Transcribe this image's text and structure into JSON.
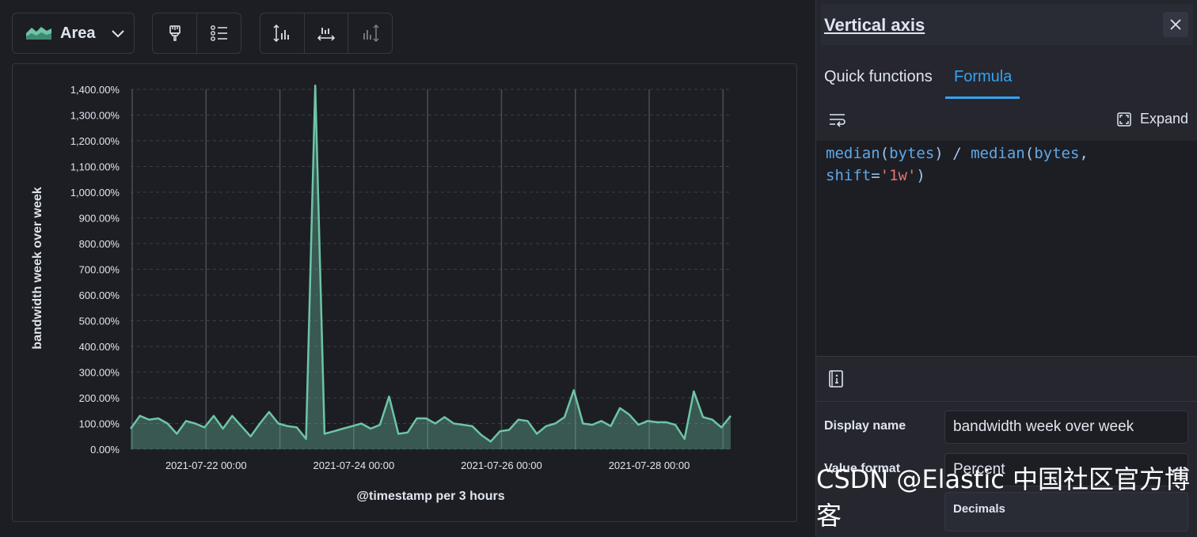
{
  "toolbar": {
    "chart_type_label": "Area",
    "icons": [
      "area-chart-icon",
      "chevron-down-icon",
      "paintbrush-icon",
      "legend-list-icon",
      "left-axis-icon",
      "bottom-axis-icon",
      "right-axis-icon"
    ]
  },
  "colors": {
    "series": "#6dc5a5",
    "accent": "#36a2ef",
    "string": "#e57373"
  },
  "chart_data": {
    "type": "area",
    "xlabel": "@timestamp per 3 hours",
    "ylabel": "bandwidth week over week",
    "ylim": [
      0,
      1400
    ],
    "y_ticks": [
      "0.00%",
      "100.00%",
      "200.00%",
      "300.00%",
      "400.00%",
      "500.00%",
      "600.00%",
      "700.00%",
      "800.00%",
      "900.00%",
      "1,000.00%",
      "1,100.00%",
      "1,200.00%",
      "1,300.00%",
      "1,400.00%"
    ],
    "x_ticks": [
      "2021-07-22 00:00",
      "2021-07-24 00:00",
      "2021-07-26 00:00",
      "2021-07-28 00:00"
    ],
    "grid": true,
    "series": [
      {
        "values": [
          80,
          130,
          115,
          120,
          100,
          60,
          110,
          100,
          85,
          130,
          80,
          130,
          90,
          50,
          100,
          145,
          100,
          90,
          85,
          40,
          1415,
          60,
          70,
          80,
          90,
          100,
          80,
          95,
          205,
          60,
          65,
          120,
          120,
          100,
          125,
          100,
          95,
          90,
          55,
          30,
          70,
          75,
          115,
          110,
          60,
          90,
          100,
          125,
          230,
          100,
          95,
          110,
          90,
          160,
          135,
          95,
          110,
          105,
          105,
          95,
          40,
          225,
          125,
          115,
          85,
          130
        ]
      }
    ]
  },
  "flyout": {
    "title": "Vertical axis",
    "tabs": [
      "Quick functions",
      "Formula"
    ],
    "expand_label": "Expand",
    "formula": {
      "f1": "median",
      "a1": "bytes",
      "op": "/",
      "f2": "median",
      "a2": "bytes",
      "shift_key": "shift",
      "shift_val": "'1w'"
    },
    "display_name_label": "Display name",
    "display_name_value": "bandwidth week over week",
    "value_format_label": "Value format",
    "value_format_value": "Percent",
    "decimals_label": "Decimals"
  },
  "watermark": "CSDN @Elastic 中国社区官方博客"
}
